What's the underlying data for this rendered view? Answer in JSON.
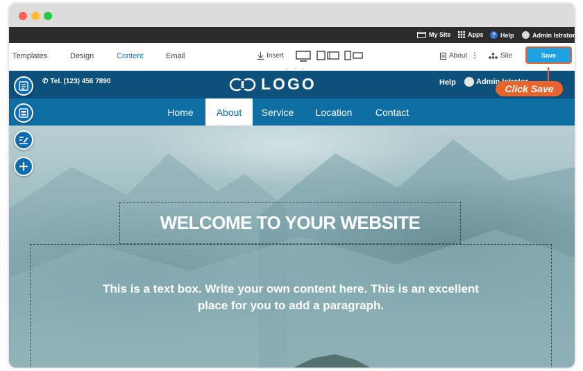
{
  "window": {
    "traffic_lights": [
      "#ff5f57",
      "#ffbd2e",
      "#28c840"
    ]
  },
  "topbar": {
    "my_site": "My Site",
    "apps": "Apps",
    "help": "Help",
    "admin": "Admin Istrator"
  },
  "toolbar": {
    "tabs": [
      "Templates",
      "Design",
      "Content",
      "Email"
    ],
    "active_tab": "Content",
    "insert": "Insert",
    "about": "About",
    "site": "Site",
    "save": "Save"
  },
  "callout": {
    "text": "Click Save"
  },
  "site_header": {
    "phone": "Tel. (123) 456 7890",
    "logo": "LOGO",
    "help": "Help",
    "admin": "Admin Istrator"
  },
  "nav": {
    "items": [
      "Home",
      "About",
      "Service",
      "Location",
      "Contact"
    ],
    "active": "About"
  },
  "hero": {
    "title": "WELCOME TO YOUR WEBSITE",
    "paragraph_line1": "This is a text box. Write your own content here. This is an excellent",
    "paragraph_line2": "place for you to add a paragraph."
  },
  "colors": {
    "accent": "#1da1e2",
    "callout": "#e8642c",
    "header": "#0d507b",
    "nav": "#0e6ea4",
    "active_link": "#0e6ea4"
  }
}
